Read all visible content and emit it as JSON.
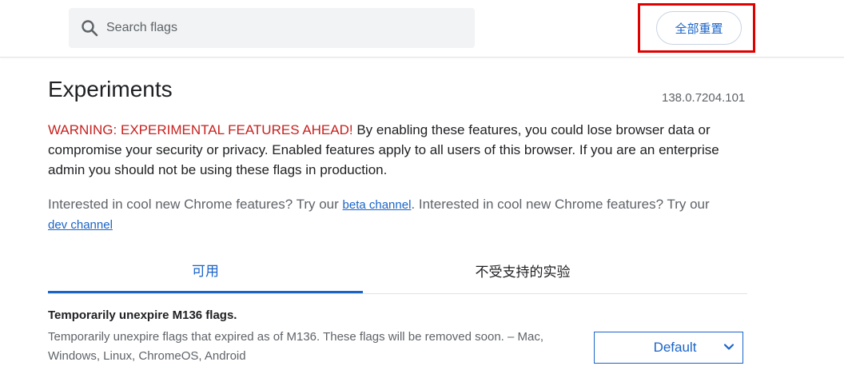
{
  "search": {
    "placeholder": "Search flags",
    "value": ""
  },
  "header": {
    "reset_all_label": "全部重置"
  },
  "main": {
    "title": "Experiments",
    "version": "138.0.7204.101",
    "warning_label": "WARNING: EXPERIMENTAL FEATURES AHEAD!",
    "warning_text": " By enabling these features, you could lose browser data or compromise your security or privacy. Enabled features apply to all users of this browser. If you are an enterprise admin you should not be using these flags in production.",
    "channel_text_1": "Interested in cool new Chrome features? Try our ",
    "beta_channel_link": "beta channel",
    "channel_text_2": ". Interested in cool new Chrome features? Try our ",
    "dev_channel_link": "dev channel"
  },
  "tabs": [
    {
      "label": "可用",
      "active": true
    },
    {
      "label": "不受支持的实验",
      "active": false
    }
  ],
  "flags": [
    {
      "title": "Temporarily unexpire M136 flags.",
      "description": "Temporarily unexpire flags that expired as of M136. These flags will be removed soon. – Mac, Windows, Linux, ChromeOS, Android",
      "selected_option": "Default"
    }
  ],
  "colors": {
    "accent": "#1a64c8",
    "warning": "#c5221f",
    "highlight": "#e00000"
  }
}
